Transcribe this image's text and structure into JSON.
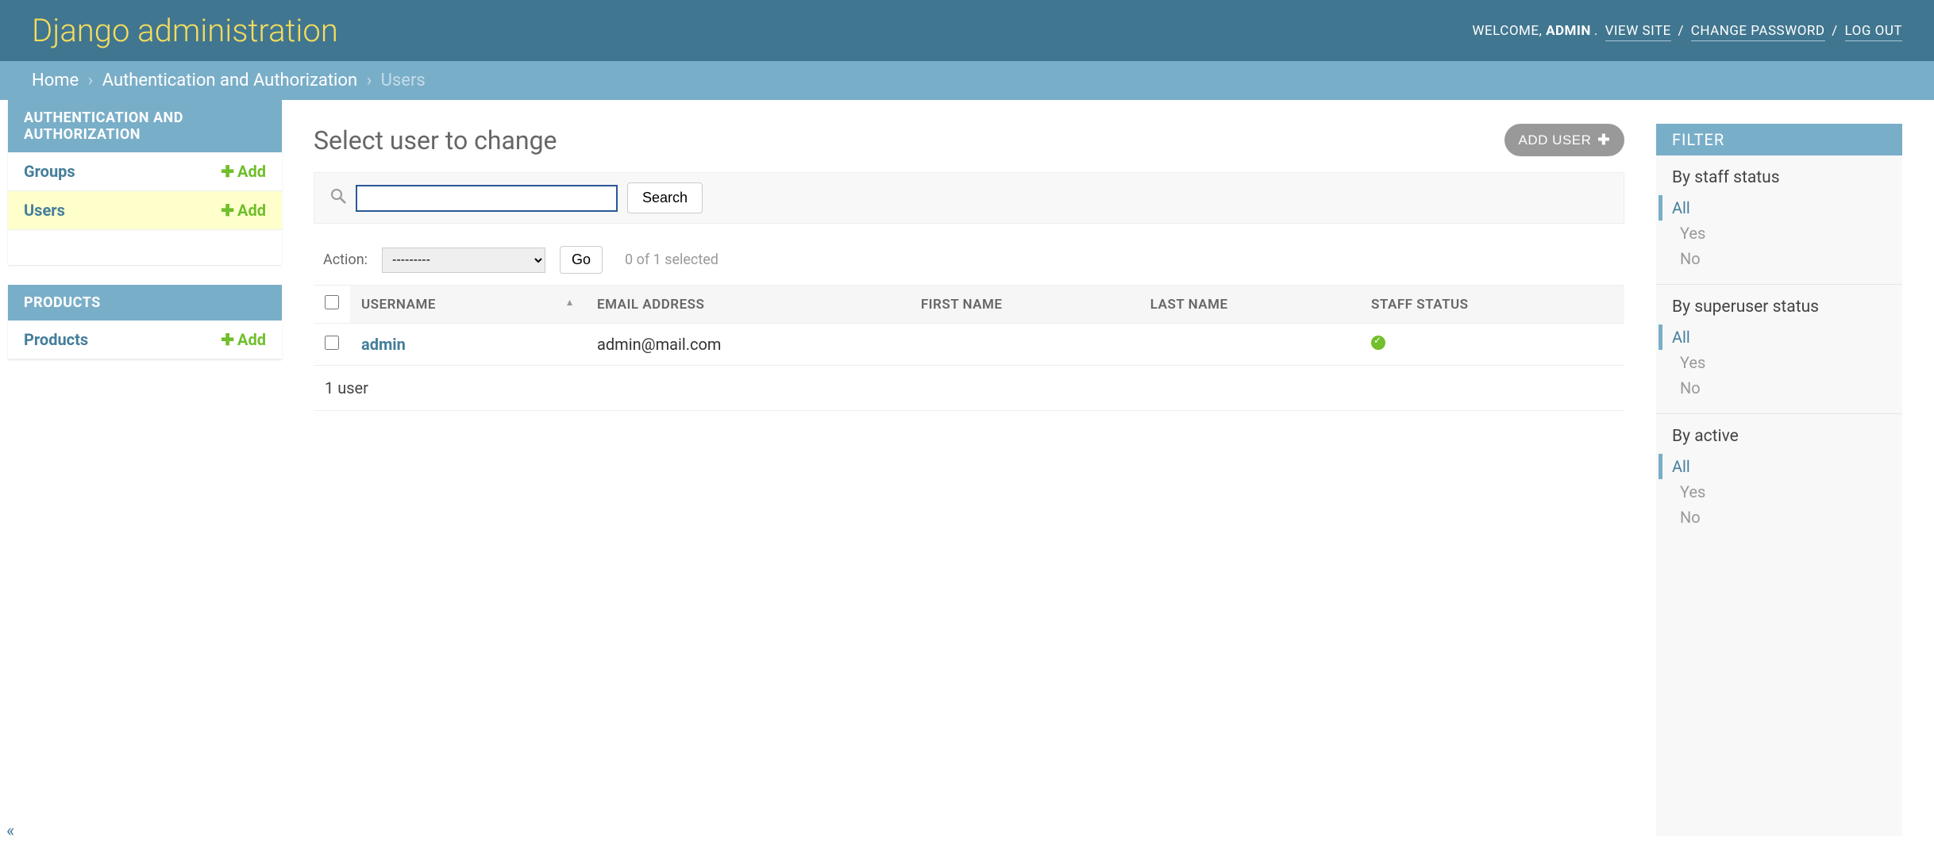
{
  "header": {
    "branding": "Django administration",
    "welcome_prefix": "WELCOME, ",
    "username": "ADMIN",
    "view_site": "VIEW SITE",
    "change_password": "CHANGE PASSWORD",
    "log_out": "LOG OUT"
  },
  "breadcrumbs": {
    "home": "Home",
    "app": "Authentication and Authorization",
    "model": "Users"
  },
  "sidebar": {
    "apps": [
      {
        "caption": "AUTHENTICATION AND AUTHORIZATION",
        "models": [
          {
            "name": "Groups",
            "add": "Add",
            "current": false
          },
          {
            "name": "Users",
            "add": "Add",
            "current": true
          }
        ]
      },
      {
        "caption": "PRODUCTS",
        "models": [
          {
            "name": "Products",
            "add": "Add",
            "current": false
          }
        ]
      }
    ]
  },
  "content": {
    "title": "Select user to change",
    "add_button": "ADD USER",
    "search_button": "Search",
    "search_value": "",
    "action_label": "Action:",
    "action_placeholder": "---------",
    "go": "Go",
    "selection_counter": "0 of 1 selected",
    "columns": [
      "USERNAME",
      "EMAIL ADDRESS",
      "FIRST NAME",
      "LAST NAME",
      "STAFF STATUS"
    ],
    "rows": [
      {
        "username": "admin",
        "email": "admin@mail.com",
        "first_name": "",
        "last_name": "",
        "staff_status": true
      }
    ],
    "paginator": "1 user"
  },
  "filter": {
    "heading": "FILTER",
    "groups": [
      {
        "title": "By staff status",
        "options": [
          "All",
          "Yes",
          "No"
        ],
        "selected": "All"
      },
      {
        "title": "By superuser status",
        "options": [
          "All",
          "Yes",
          "No"
        ],
        "selected": "All"
      },
      {
        "title": "By active",
        "options": [
          "All",
          "Yes",
          "No"
        ],
        "selected": "All"
      }
    ]
  }
}
